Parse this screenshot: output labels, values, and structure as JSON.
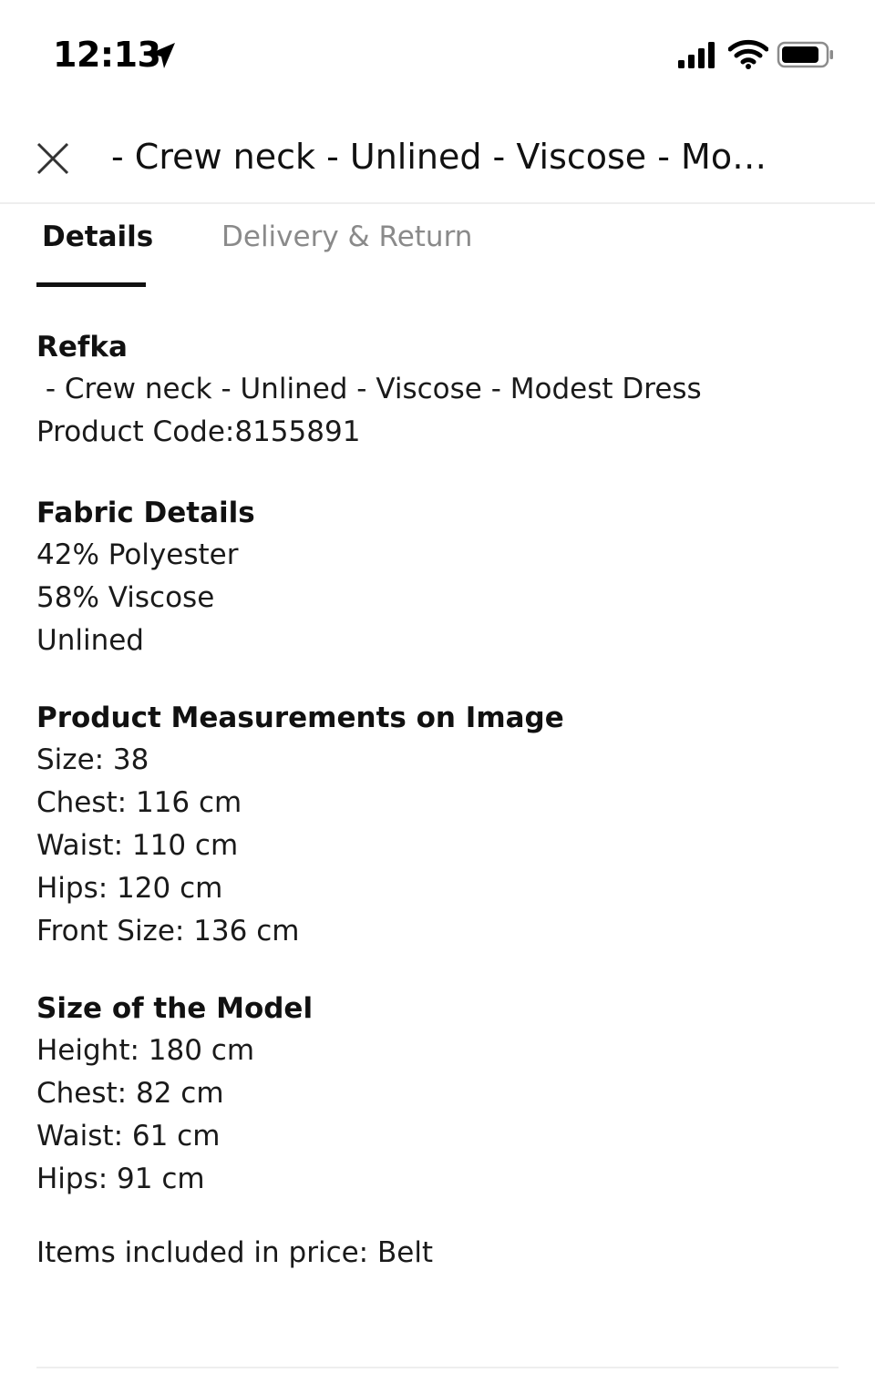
{
  "status_bar": {
    "time": "12:13"
  },
  "header": {
    "title": "- Crew neck - Unlined - Viscose - Mode..."
  },
  "tabs": [
    {
      "label": "Details",
      "active": true
    },
    {
      "label": "Delivery & Return",
      "active": false
    }
  ],
  "product": {
    "brand": "Refka",
    "name": " - Crew neck - Unlined - Viscose - Modest Dress",
    "code": "Product Code:8155891"
  },
  "fabric": {
    "title": "Fabric Details",
    "lines": [
      "42% Polyester",
      "58% Viscose",
      "Unlined"
    ]
  },
  "measurements": {
    "title": "Product Measurements on Image",
    "lines": [
      "Size: 38",
      "Chest: 116 cm",
      "Waist: 110 cm",
      "Hips: 120 cm",
      "Front Size: 136 cm"
    ]
  },
  "model": {
    "title": "Size of the Model",
    "lines": [
      "Height: 180 cm",
      "Chest: 82 cm",
      "Waist: 61 cm",
      "Hips: 91 cm"
    ]
  },
  "included": "Items included in price: Belt",
  "colors": {
    "text": "#111111",
    "inactive_tab": "#8a8a8a",
    "divider": "#eeeeee"
  }
}
